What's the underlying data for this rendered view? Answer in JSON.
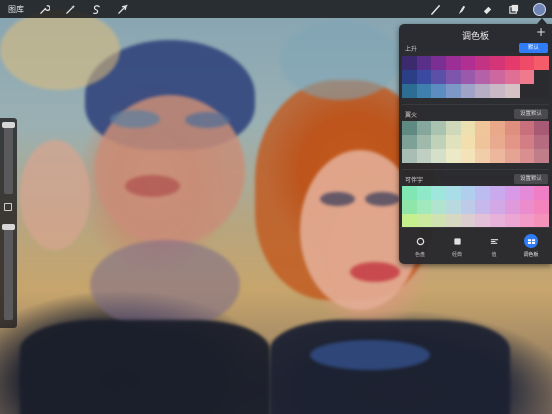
{
  "toolbar": {
    "gallery_label": "图库",
    "left_icons": [
      "wrench-icon",
      "magic-wand-icon",
      "selection-icon",
      "transform-arrow-icon"
    ],
    "right_icons": [
      "brush-icon",
      "smudge-icon",
      "eraser-icon",
      "layers-icon",
      "color-icon"
    ],
    "current_color": "#6f86b5"
  },
  "panel": {
    "title": "调色板",
    "add_symbol": "+",
    "palettes": [
      {
        "name": "上升",
        "button": "默认",
        "rows": [
          [
            "#3b2a6e",
            "#5a2f8a",
            "#7a2f93",
            "#9c2f96",
            "#b12f93",
            "#c23384",
            "#d43577",
            "#e43b6c",
            "#ef4a67",
            "#f55c6a"
          ],
          [
            "#2a3f86",
            "#3b4aa0",
            "#5a50a8",
            "#7d55ac",
            "#9a5aac",
            "#b561aa",
            "#cc67a0",
            "#e06f96",
            "#ef7a8d",
            "#2b2b2f"
          ],
          [
            "#2e6d93",
            "#3e7fae",
            "#5c8dc0",
            "#7d98c6",
            "#9ea3c7",
            "#b7aec6",
            "#c9b9c6",
            "#d6c2c5",
            "#2b2b2f",
            "#2b2b2f"
          ]
        ]
      },
      {
        "name": "翼火",
        "button": "设置默认",
        "rows": [
          [
            "#5f8a82",
            "#86a89c",
            "#aac3b1",
            "#cfd8b9",
            "#ecdfb0",
            "#eec69a",
            "#e8a889",
            "#df8f7e",
            "#c9707c",
            "#a85a75"
          ],
          [
            "#7da197",
            "#9fb9ab",
            "#c0d1b9",
            "#e0e2bd",
            "#f3dfae",
            "#f0c49b",
            "#e9ab8f",
            "#e39687",
            "#d27e84",
            "#b56c80"
          ],
          [
            "#a8bdb3",
            "#bfcfc2",
            "#d5e0cb",
            "#ebe9c6",
            "#f4e3b8",
            "#f2cda9",
            "#ecb79d",
            "#e5a394",
            "#d98f8f",
            "#c07d8a"
          ]
        ]
      },
      {
        "name": "可伴宇",
        "button": "设置默认",
        "rows": [
          [
            "#7fe6b4",
            "#8fe9c9",
            "#9fe6dc",
            "#a9dde8",
            "#b0cfee",
            "#bbbdf0",
            "#c9aaee",
            "#d89ae6",
            "#e58ad8",
            "#f07ec6"
          ],
          [
            "#8ee6a8",
            "#a1e8bd",
            "#b0e4cf",
            "#b9d9e0",
            "#bdcbe8",
            "#c6b8ea",
            "#d2a8e6",
            "#df9adc",
            "#eb8dcd",
            "#f385bc"
          ],
          [
            "#c6f08e",
            "#cbeaa0",
            "#d1e2b2",
            "#d6d8c2",
            "#dccdd0",
            "#e1c0d8",
            "#e6b2da",
            "#eca6d4",
            "#f19bc9",
            "#f592bc"
          ]
        ]
      }
    ],
    "tabs": [
      {
        "label": "色盘",
        "icon": "color-disc-icon",
        "active": false
      },
      {
        "label": "经典",
        "icon": "classic-square-icon",
        "active": false
      },
      {
        "label": "值",
        "icon": "value-sliders-icon",
        "active": false
      },
      {
        "label": "调色板",
        "icon": "palette-grid-icon",
        "active": true
      }
    ]
  }
}
